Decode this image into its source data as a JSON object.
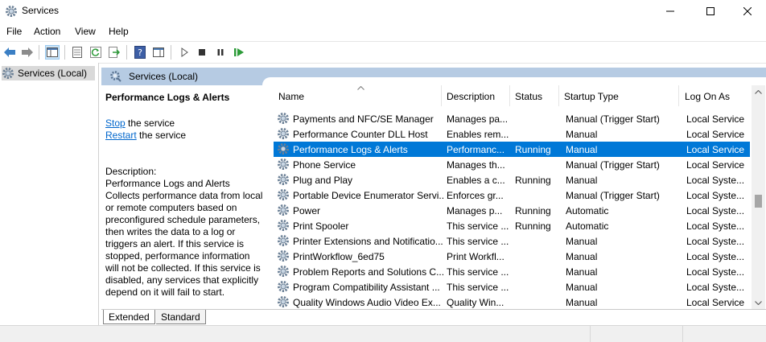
{
  "window": {
    "title": "Services"
  },
  "menu": {
    "file": "File",
    "action": "Action",
    "view": "View",
    "help": "Help"
  },
  "tree": {
    "root": "Services (Local)"
  },
  "pane": {
    "header": "Services (Local)"
  },
  "details": {
    "title": "Performance Logs & Alerts",
    "stop_link": "Stop",
    "stop_suffix": " the service",
    "restart_link": "Restart",
    "restart_suffix": " the service",
    "description_label": "Description:",
    "description": "Performance Logs and Alerts Collects performance data from local or remote computers based on preconfigured schedule parameters, then writes the data to a log or triggers an alert. If this service is stopped, performance information will not be collected. If this service is disabled, any services that explicitly depend on it will fail to start."
  },
  "columns": {
    "name": "Name",
    "description": "Description",
    "status": "Status",
    "startup": "Startup Type",
    "logon": "Log On As"
  },
  "rows": [
    {
      "name": "Payments and NFC/SE Manager",
      "description": "Manages pa...",
      "status": "",
      "startup": "Manual (Trigger Start)",
      "logon": "Local Service"
    },
    {
      "name": "Performance Counter DLL Host",
      "description": "Enables rem...",
      "status": "",
      "startup": "Manual",
      "logon": "Local Service"
    },
    {
      "name": "Performance Logs & Alerts",
      "description": "Performanc...",
      "status": "Running",
      "startup": "Manual",
      "logon": "Local Service",
      "selected": true
    },
    {
      "name": "Phone Service",
      "description": "Manages th...",
      "status": "",
      "startup": "Manual (Trigger Start)",
      "logon": "Local Service"
    },
    {
      "name": "Plug and Play",
      "description": "Enables a c...",
      "status": "Running",
      "startup": "Manual",
      "logon": "Local Syste..."
    },
    {
      "name": "Portable Device Enumerator Servi...",
      "description": "Enforces gr...",
      "status": "",
      "startup": "Manual (Trigger Start)",
      "logon": "Local Syste..."
    },
    {
      "name": "Power",
      "description": "Manages p...",
      "status": "Running",
      "startup": "Automatic",
      "logon": "Local Syste..."
    },
    {
      "name": "Print Spooler",
      "description": "This service ...",
      "status": "Running",
      "startup": "Automatic",
      "logon": "Local Syste..."
    },
    {
      "name": "Printer Extensions and Notificatio...",
      "description": "This service ...",
      "status": "",
      "startup": "Manual",
      "logon": "Local Syste..."
    },
    {
      "name": "PrintWorkflow_6ed75",
      "description": "Print Workfl...",
      "status": "",
      "startup": "Manual",
      "logon": "Local Syste..."
    },
    {
      "name": "Problem Reports and Solutions C...",
      "description": "This service ...",
      "status": "",
      "startup": "Manual",
      "logon": "Local Syste..."
    },
    {
      "name": "Program Compatibility Assistant ...",
      "description": "This service ...",
      "status": "",
      "startup": "Manual",
      "logon": "Local Syste..."
    },
    {
      "name": "Quality Windows Audio Video Ex...",
      "description": "Quality Win...",
      "status": "",
      "startup": "Manual",
      "logon": "Local Service"
    }
  ],
  "tabs": {
    "extended": "Extended",
    "standard": "Standard"
  },
  "colors": {
    "selection": "#0078d7",
    "pane_header": "#b6cbe3",
    "link": "#0066cc"
  }
}
